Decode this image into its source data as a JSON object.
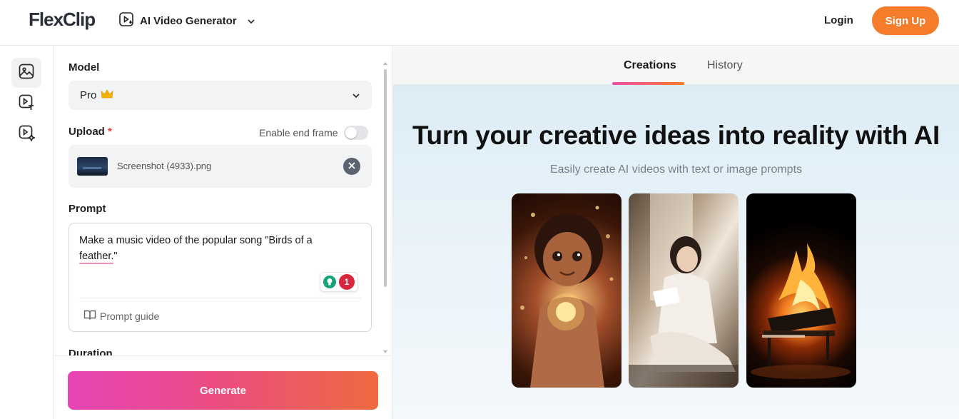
{
  "header": {
    "logo": "FlexClip",
    "product_label": "AI Video Generator",
    "login_label": "Login",
    "signup_label": "Sign Up"
  },
  "rail": {
    "items": [
      "image-to-video-icon",
      "text-to-video-icon",
      "ai-video-icon"
    ]
  },
  "form": {
    "model_label": "Model",
    "model_value": "Pro",
    "upload_label": "Upload",
    "upload_required": "*",
    "end_frame_label": "Enable end frame",
    "upload_filename": "Screenshot (4933).png",
    "prompt_label": "Prompt",
    "prompt_value": "Make a music video of the popular song \"Birds of a feather.\"",
    "grammar_count": "1",
    "prompt_guide_label": "Prompt guide",
    "duration_label": "Duration",
    "generate_label": "Generate"
  },
  "right": {
    "tabs": [
      "Creations",
      "History"
    ],
    "hero_title": "Turn your creative ideas into reality with AI",
    "hero_subtitle": "Easily create AI videos with text or image prompts"
  },
  "colors": {
    "brand_orange": "#f57c2a",
    "accent_pink": "#ee4d8a"
  }
}
